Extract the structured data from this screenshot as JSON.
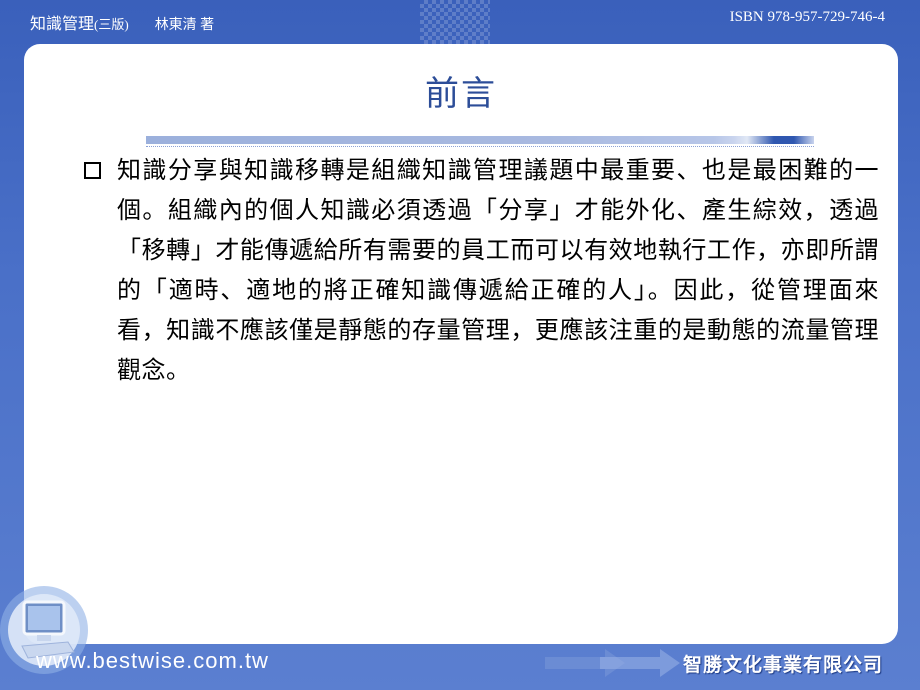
{
  "header": {
    "book_title": "知識管理",
    "edition": "(三版)",
    "author": "林東清 著",
    "isbn": "ISBN 978-957-729-746-4"
  },
  "slide": {
    "title": "前言",
    "bullet_text": "知識分享與知識移轉是組織知識管理議題中最重要、也是最困難的一個。組織內的個人知識必須透過「分享」才能外化、產生綜效，透過「移轉」才能傳遞給所有需要的員工而可以有效地執行工作，亦即所謂的「適時、適地的將正確知識傳遞給正確的人」。因此，從管理面來看，知識不應該僅是靜態的存量管理，更應該注重的是動態的流量管理觀念。"
  },
  "footer": {
    "url": "www.bestwise.com.tw",
    "company": "智勝文化事業有限公司"
  },
  "icons": {
    "computer": "computer-icon",
    "arrows": "arrow-decoration-icon"
  },
  "colors": {
    "background": "#3f64bd",
    "title": "#2c4d98",
    "panel": "#ffffff"
  }
}
